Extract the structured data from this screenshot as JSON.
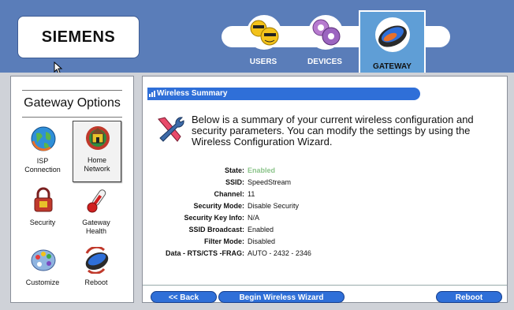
{
  "brand": "SIEMENS",
  "tabs": [
    {
      "label": "USERS",
      "icon": "smiley-users-icon"
    },
    {
      "label": "DEVICES",
      "icon": "devices-icon"
    },
    {
      "label": "GATEWAY",
      "icon": "gateway-icon",
      "active": true
    }
  ],
  "sidebar": {
    "title": "Gateway Options",
    "items": [
      {
        "label_line1": "ISP",
        "label_line2": "Connection",
        "icon": "globe-icon"
      },
      {
        "label_line1": "Home",
        "label_line2": "Network",
        "icon": "home-network-icon",
        "active": true
      },
      {
        "label_line1": "Security",
        "label_line2": "",
        "icon": "padlock-icon"
      },
      {
        "label_line1": "Gateway",
        "label_line2": "Health",
        "icon": "thermometer-icon"
      },
      {
        "label_line1": "Customize",
        "label_line2": "",
        "icon": "palette-icon"
      },
      {
        "label_line1": "Reboot",
        "label_line2": "",
        "icon": "reboot-icon"
      }
    ]
  },
  "content": {
    "section_title": "Wireless Summary",
    "intro": "Below is a summary of your current wireless configuration and security parameters. You can modify the settings by using the Wireless Configuration Wizard.",
    "fields": [
      {
        "label": "State:",
        "value": "Enabled"
      },
      {
        "label": "SSID:",
        "value": "SpeedStream"
      },
      {
        "label": "Channel:",
        "value": "11"
      },
      {
        "label": "Security Mode:",
        "value": "Disable Security"
      },
      {
        "label": "Security Key Info:",
        "value": "N/A"
      },
      {
        "label": "SSID Broadcast:",
        "value": "Enabled"
      },
      {
        "label": "Filter Mode:",
        "value": "Disabled"
      },
      {
        "label": "Data - RTS/CTS -FRAG:",
        "value": "AUTO - 2432 - 2346"
      }
    ],
    "buttons": {
      "back": "<< Back",
      "wizard": "Begin Wireless Wizard",
      "reboot": "Reboot"
    }
  },
  "colors": {
    "header_blue": "#5a7db9",
    "accent_blue": "#2f6fd8",
    "enabled_green": "#8bc48a"
  }
}
